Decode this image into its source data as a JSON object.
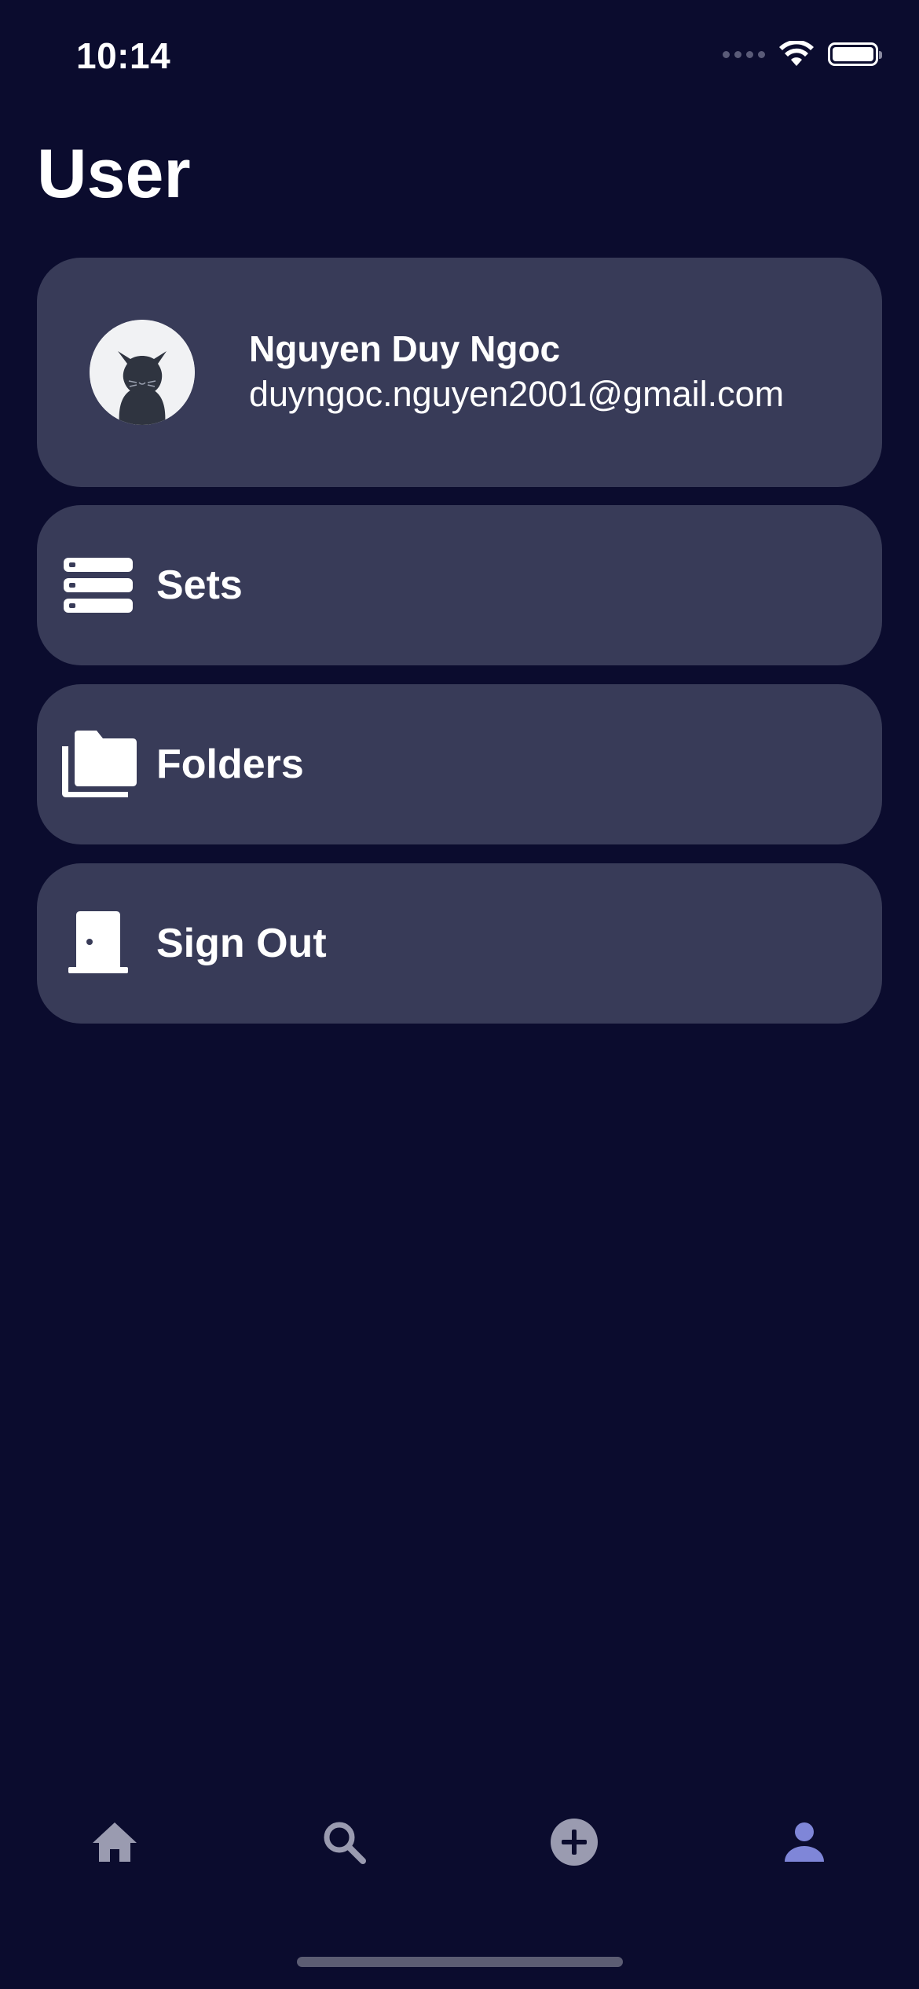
{
  "status_bar": {
    "time": "10:14"
  },
  "page": {
    "title": "User"
  },
  "profile": {
    "name": "Nguyen Duy Ngoc",
    "email": "duyngoc.nguyen2001@gmail.com",
    "avatar_icon": "cat-avatar-icon"
  },
  "menu": {
    "items": [
      {
        "label": "Sets",
        "icon": "sets-stack-icon"
      },
      {
        "label": "Folders",
        "icon": "folders-icon"
      },
      {
        "label": "Sign Out",
        "icon": "door-icon"
      }
    ]
  },
  "bottom_nav": {
    "items": [
      {
        "icon": "home-icon",
        "active": false
      },
      {
        "icon": "search-icon",
        "active": false
      },
      {
        "icon": "add-circle-icon",
        "active": false
      },
      {
        "icon": "person-icon",
        "active": true
      }
    ]
  },
  "colors": {
    "background": "#0b0c2e",
    "card": "#383b58",
    "nav_inactive": "#9a9bb0",
    "nav_active": "#7f86d8"
  }
}
